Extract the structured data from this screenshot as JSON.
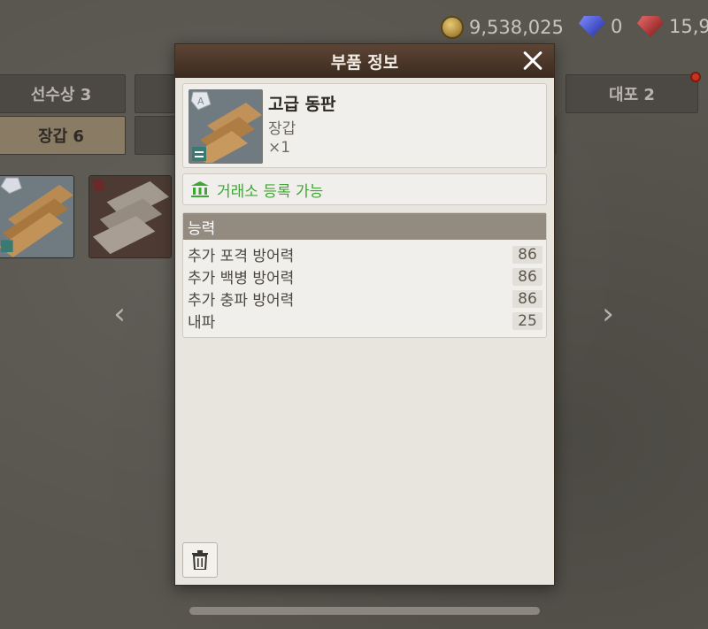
{
  "currency": {
    "gold": "9,538,025",
    "blue_gem": "0",
    "red_gem": "15,9"
  },
  "background_tabs": {
    "tab1": "선수상 3",
    "tab2": "장갑 6",
    "tab3": "대포 2"
  },
  "modal": {
    "title": "부품 정보",
    "item": {
      "name": "고급 동판",
      "type": "장갑",
      "quantity": "×1",
      "grade_letter": "A"
    },
    "market_label": "거래소 등록 가능",
    "ability": {
      "header": "능력",
      "stats": [
        {
          "name": "추가 포격 방어력",
          "value": "86"
        },
        {
          "name": "추가 백병 방어력",
          "value": "86"
        },
        {
          "name": "추가 충파 방어력",
          "value": "86"
        },
        {
          "name": "내파",
          "value": "25"
        }
      ]
    }
  },
  "colors": {
    "header_brown": "#4a3628",
    "market_green": "#3fa536",
    "ability_header": "#948b80"
  }
}
